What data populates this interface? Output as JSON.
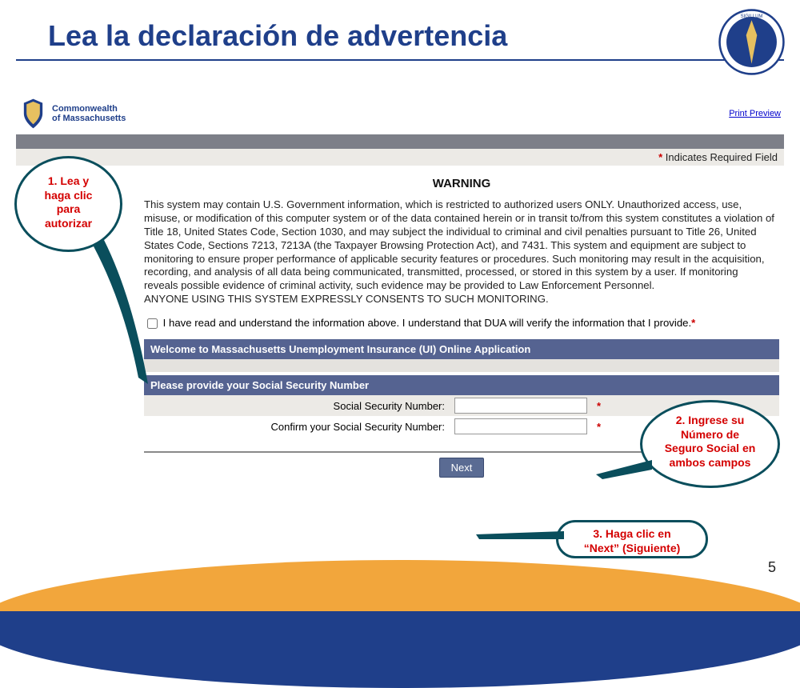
{
  "slide": {
    "title": "Lea la declaración de advertencia",
    "page_number": "5"
  },
  "header": {
    "org_line1": "Commonwealth",
    "org_line2": "of Massachusetts",
    "print_link": "Print Preview"
  },
  "required_notice": {
    "star": "*",
    "text": " Indicates Required Field"
  },
  "warning": {
    "heading": "WARNING",
    "body": "This system may contain U.S. Government information, which is restricted to authorized users ONLY. Unauthorized access, use, misuse, or modification of this computer system or of the data contained herein or in transit to/from this system constitutes a violation of Title 18, United States Code, Section 1030, and may subject the individual to criminal and civil penalties pursuant to Title 26, United States Code, Sections 7213, 7213A (the Taxpayer Browsing Protection Act), and 7431. This system and equipment are subject to monitoring to ensure proper performance of applicable security features or procedures. Such monitoring may result in the acquisition, recording, and analysis of all data being communicated, transmitted, processed, or stored in this system by a user. If monitoring reveals possible evidence of criminal activity, such evidence may be provided to Law Enforcement Personnel.",
    "consent_line": "ANYONE USING THIS SYSTEM EXPRESSLY CONSENTS TO SUCH MONITORING."
  },
  "checkbox": {
    "label": "I have read and understand the information above. I understand that DUA will verify the information that I provide.",
    "star": "*"
  },
  "panels": {
    "welcome": "Welcome to Massachusetts Unemployment Insurance (UI) Online Application",
    "ssn_header": "Please provide your Social Security Number"
  },
  "fields": {
    "ssn_label": "Social Security Number:",
    "ssn_confirm_label": "Confirm your Social Security Number:",
    "star": "*"
  },
  "buttons": {
    "next": "Next"
  },
  "callouts": {
    "c1_l1": "1. Lea y",
    "c1_l2": "haga clic",
    "c1_l3": "para",
    "c1_l4": "autorizar",
    "c2_l1": "2. Ingrese su",
    "c2_l2": "Número de",
    "c2_l3": "Seguro Social en",
    "c2_l4": "ambos campos",
    "c3_l1": "3. Haga clic en",
    "c3_l2": "“Next” (Siguiente)"
  }
}
